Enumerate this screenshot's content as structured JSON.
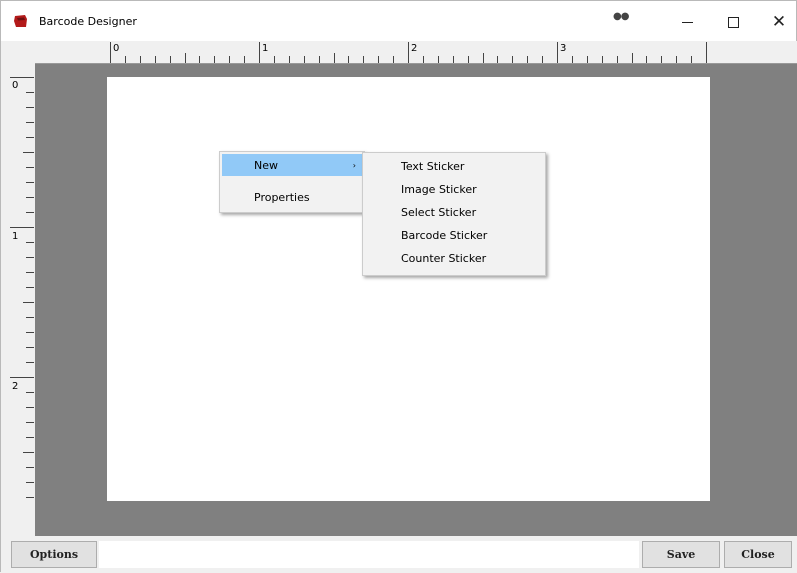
{
  "window": {
    "title": "Barcode Designer",
    "icons": {
      "app": "sticker-app-icon",
      "extra": "more-dots-icon"
    },
    "controls": {
      "minimize": "minimize-icon",
      "maximize": "maximize-icon",
      "close": "close-icon"
    }
  },
  "rulers": {
    "top_labels": [
      "0",
      "1",
      "2",
      "3"
    ],
    "left_labels": [
      "0",
      "1",
      "2"
    ]
  },
  "canvas": {
    "background": "#808080",
    "page_color": "#ffffff"
  },
  "context_menu": {
    "items": [
      {
        "label": "New",
        "has_submenu": true,
        "highlighted": true
      },
      {
        "label": "Properties",
        "has_submenu": false,
        "highlighted": false
      }
    ],
    "submenu_arrow": "›"
  },
  "submenu": {
    "items": [
      {
        "label": "Text Sticker"
      },
      {
        "label": "Image Sticker"
      },
      {
        "label": "Select Sticker"
      },
      {
        "label": "Barcode Sticker"
      },
      {
        "label": "Counter Sticker"
      }
    ]
  },
  "bottom": {
    "options_label": "Options",
    "save_label": "Save",
    "close_label": "Close"
  },
  "colors": {
    "highlight": "#91c9f7",
    "icon_red": "#b31a1a"
  }
}
